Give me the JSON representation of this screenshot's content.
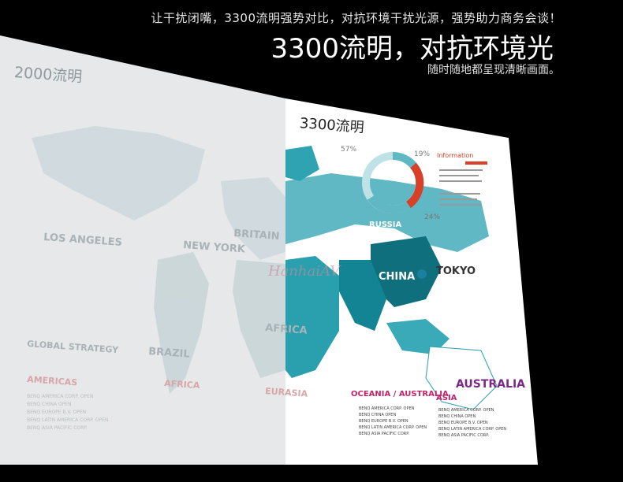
{
  "banner": {
    "top_line": "让干扰闭嘴，3300流明强势对比，对抗环境干扰光源，强势助力商务会谈！",
    "headline": "3300流明，对抗环境光",
    "subline": "随时随地都呈现清晰画面。"
  },
  "labels": {
    "low": "2000流明",
    "high": "3300流明"
  },
  "map": {
    "left_cities": [
      "LOS ANGELES",
      "NEW YORK",
      "BRITAIN",
      "BRAZIL",
      "AFRICA",
      "EURASIA"
    ],
    "global_strategy": "GLOBAL STRATEGY",
    "americas": "AMERICAS",
    "left_lines": [
      "BENQ AMERICA CORP. OPEN",
      "BENQ CHINA OPEN",
      "BENQ EUROPE B.V. OPEN",
      "BENQ LATIN AMERICA CORP. OPEN",
      "BENQ ASIA PACIFIC CORP."
    ],
    "right_cities": [
      "RUSSIA",
      "CHINA",
      "TOKYO",
      "AUSTRALIA"
    ],
    "oceania": "OCEANIA / AUSTRALIA",
    "asia": "ASIA",
    "info_title": "Information",
    "percent_57": "57%",
    "percent_19": "19%",
    "percent_24": "24%",
    "watermark": "HanhaiAV"
  },
  "colors": {
    "teal": "#1e9aaa",
    "dark_teal": "#0f6f7d",
    "red": "#d84028",
    "purple": "#7a2a86",
    "pink": "#c4246c"
  }
}
